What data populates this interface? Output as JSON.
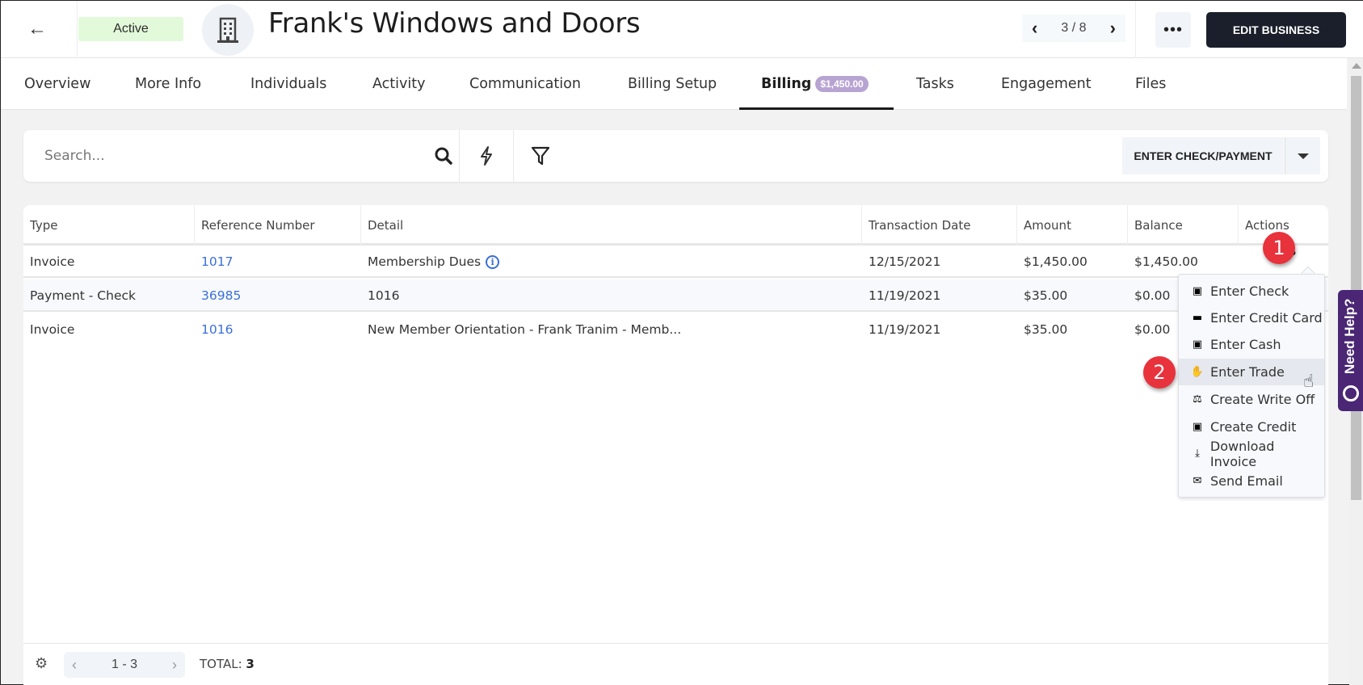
{
  "header": {
    "back_icon": "arrow-left-icon",
    "status": "Active",
    "entity_icon": "building-icon",
    "title": "Frank's Windows and Doors",
    "pager": {
      "prev": "‹",
      "text": "3 / 8",
      "next": "›"
    },
    "more_icon": "more-horizontal-icon",
    "more_label": "•••",
    "edit_label": "EDIT BUSINESS"
  },
  "tabs": [
    {
      "label": "Overview"
    },
    {
      "label": "More Info"
    },
    {
      "label": "Individuals"
    },
    {
      "label": "Activity"
    },
    {
      "label": "Communication"
    },
    {
      "label": "Billing Setup"
    },
    {
      "label": "Billing",
      "badge": "$1,450.00",
      "active": true
    },
    {
      "label": "Tasks"
    },
    {
      "label": "Engagement"
    },
    {
      "label": "Files"
    }
  ],
  "toolbar": {
    "search_placeholder": "Search...",
    "search_icon": "search-icon",
    "quick_icon": "lightning-icon",
    "filter_icon": "filter-icon",
    "enter_payment_label": "ENTER CHECK/PAYMENT",
    "dropdown_icon": "caret-down-icon"
  },
  "table": {
    "columns": [
      "Type",
      "Reference Number",
      "Detail",
      "Transaction Date",
      "Amount",
      "Balance",
      "Actions"
    ],
    "rows": [
      {
        "type": "Invoice",
        "ref": "1017",
        "detail": "Membership Dues",
        "detail_info": true,
        "date": "12/15/2021",
        "amount": "$1,450.00",
        "balance": "$1,450.00"
      },
      {
        "type": "Payment - Check",
        "ref": "36985",
        "detail": "1016",
        "date": "11/19/2021",
        "amount": "$35.00",
        "balance": "$0.00"
      },
      {
        "type": "Invoice",
        "ref": "1016",
        "detail": "New Member Orientation - Frank Tranim - Memb...",
        "date": "11/19/2021",
        "amount": "$35.00",
        "balance": "$0.00"
      }
    ],
    "actions_icon": "more-horizontal-icon",
    "actions_label": "•••"
  },
  "actions_menu": [
    {
      "label": "Enter Check",
      "icon": "money-bill-icon",
      "glyph": "▣"
    },
    {
      "label": "Enter Credit Card",
      "icon": "credit-card-icon",
      "glyph": "▬"
    },
    {
      "label": "Enter Cash",
      "icon": "money-bill-icon",
      "glyph": "▣"
    },
    {
      "label": "Enter Trade",
      "icon": "handshake-icon",
      "glyph": "✋",
      "hover": true
    },
    {
      "label": "Create Write Off",
      "icon": "balance-scale-icon",
      "glyph": "⚖"
    },
    {
      "label": "Create Credit",
      "icon": "money-bill-wave-icon",
      "glyph": "▣"
    },
    {
      "label": "Download Invoice",
      "icon": "download-icon",
      "glyph": "⤓"
    },
    {
      "label": "Send Email",
      "icon": "envelope-icon",
      "glyph": "✉"
    }
  ],
  "callouts": [
    "1",
    "2"
  ],
  "help": {
    "label": "Need Help?",
    "icon": "lifebuoy-icon"
  },
  "footer": {
    "settings_icon": "gear-icon",
    "prev": "‹",
    "range": "1 - 3",
    "next": "›",
    "total_label": "TOTAL:",
    "total_value": "3"
  }
}
